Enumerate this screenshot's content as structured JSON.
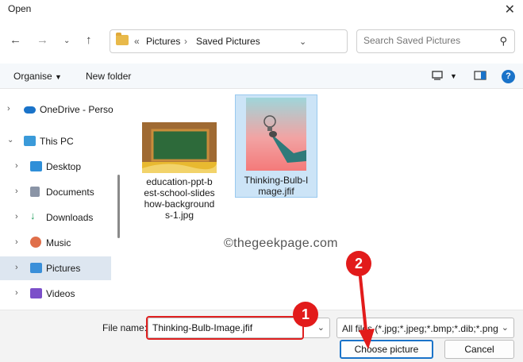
{
  "window": {
    "title": "Open"
  },
  "address": {
    "overflow": "«",
    "crumbs": [
      "Pictures",
      "Saved Pictures"
    ],
    "separator": "›"
  },
  "search": {
    "placeholder": "Search Saved Pictures"
  },
  "commandbar": {
    "organise": "Organise",
    "new_folder": "New folder",
    "help": "?"
  },
  "nav": {
    "items": [
      {
        "label": "OneDrive - Perso",
        "icon": "cloud-icon"
      },
      {
        "label": "This PC",
        "icon": "monitor-icon"
      },
      {
        "label": "Desktop",
        "icon": "desktop-icon"
      },
      {
        "label": "Documents",
        "icon": "documents-icon"
      },
      {
        "label": "Downloads",
        "icon": "download-icon"
      },
      {
        "label": "Music",
        "icon": "music-icon"
      },
      {
        "label": "Pictures",
        "icon": "pictures-icon",
        "selected": true
      },
      {
        "label": "Videos",
        "icon": "videos-icon"
      }
    ]
  },
  "files": [
    {
      "name_lines": [
        "education-ppt-b",
        "est-school-slides",
        "how-background",
        "s-1.jpg"
      ],
      "selected": false
    },
    {
      "name_lines": [
        "Thinking-Bulb-I",
        "mage.jfif"
      ],
      "selected": true
    }
  ],
  "watermark": "©thegeekpage.com",
  "footer": {
    "file_name_label": "File name:",
    "file_name_value": "Thinking-Bulb-Image.jfif",
    "filter_value": "All files (*.jpg;*.jpeg;*.bmp;*.dib;*.png",
    "choose_label": "Choose picture",
    "cancel_label": "Cancel"
  },
  "annotations": {
    "badge1": "1",
    "badge2": "2",
    "color": "#e21b1b"
  }
}
